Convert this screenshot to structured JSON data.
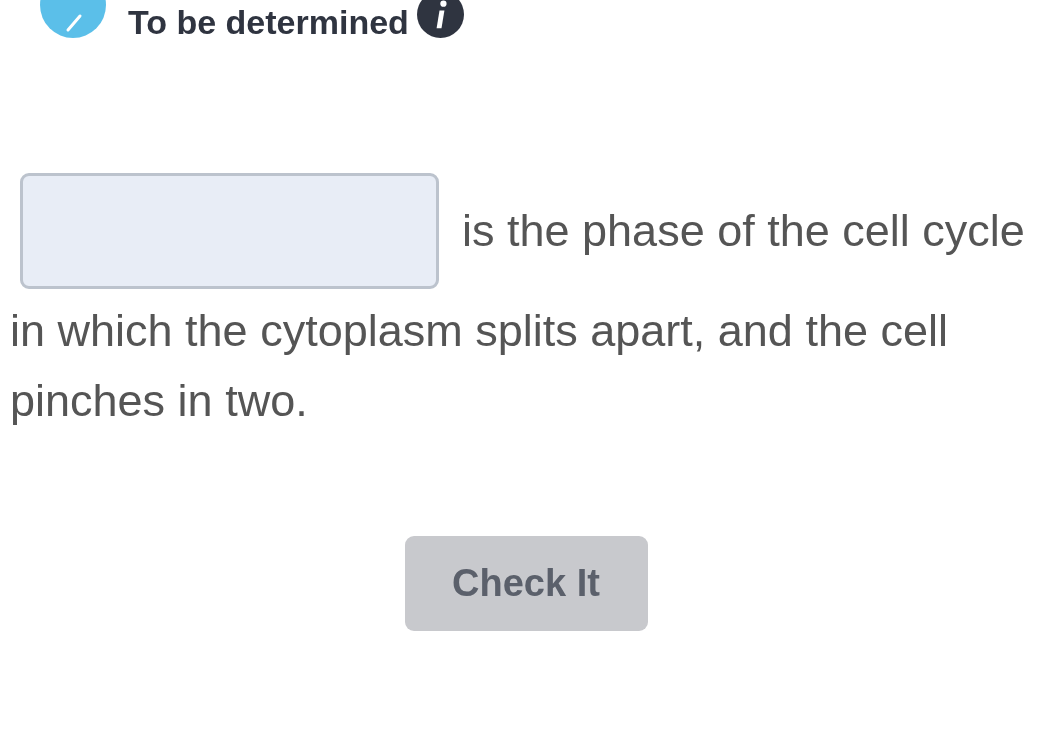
{
  "header": {
    "title": "To be determined"
  },
  "question": {
    "text": [
      "is the phase of the cell cycle",
      "in which the cytoplasm splits apart, and the cell pinches in two."
    ]
  },
  "button": {
    "label": "Check It",
    "disabled": true
  }
}
